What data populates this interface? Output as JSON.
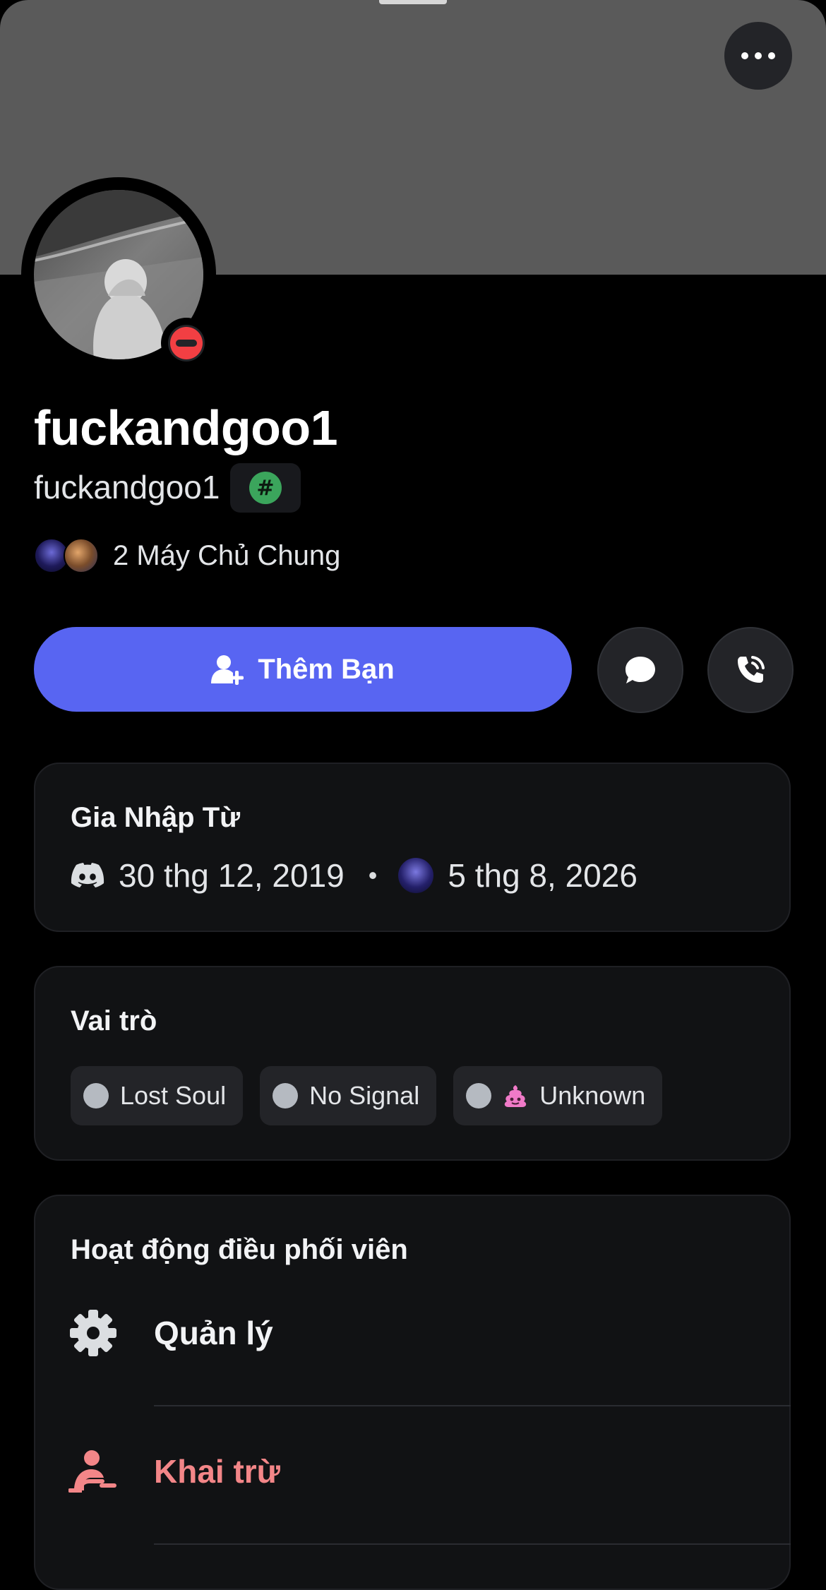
{
  "profile": {
    "display_name": "fuckandgoo1",
    "username": "fuckandgoo1",
    "tag_symbol": "#",
    "mutual_servers_label": "2 Máy Chủ Chung"
  },
  "actions": {
    "add_friend_label": "Thêm Bạn",
    "message_icon": "chat-bubble-icon",
    "call_icon": "phone-call-icon"
  },
  "joined": {
    "title": "Gia Nhập Từ",
    "discord_date": "30 thg 12, 2019",
    "separator": "•",
    "server_date": "5 thg 8, 2026"
  },
  "roles": {
    "title": "Vai trò",
    "items": [
      {
        "label": "Lost Soul",
        "emoji": ""
      },
      {
        "label": "No Signal",
        "emoji": ""
      },
      {
        "label": "Unknown",
        "emoji": "poop-emoji"
      }
    ]
  },
  "moderation": {
    "title": "Hoạt động điều phối viên",
    "items": [
      {
        "label": "Quản lý",
        "icon": "gear-icon"
      },
      {
        "label": "Khai trừ",
        "icon": "kick-user-icon"
      }
    ]
  },
  "colors": {
    "banner": "#5a5a5a",
    "brand": "#5865f2",
    "dnd_status": "#f23f43",
    "danger_text": "#f38688",
    "card_bg": "#111214"
  }
}
